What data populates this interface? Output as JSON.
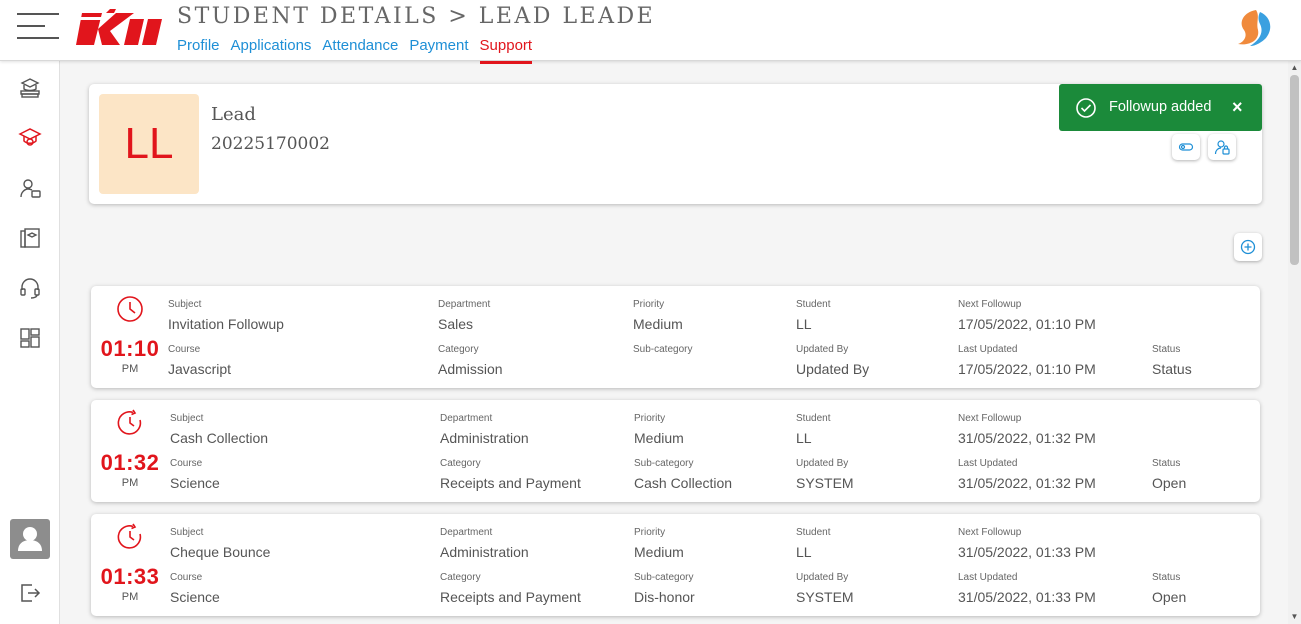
{
  "header": {
    "title": "STUDENT DETAILS > LEAD LEADE",
    "tabs": [
      {
        "label": "Profile",
        "active": false
      },
      {
        "label": "Applications",
        "active": false
      },
      {
        "label": "Attendance",
        "active": false
      },
      {
        "label": "Payment",
        "active": false
      },
      {
        "label": "Support",
        "active": true
      }
    ]
  },
  "icons": {
    "menu": "hamburger-icon",
    "logo": "kii-logo",
    "brand": "swirl-brand-icon",
    "sidebar": [
      "books-icon",
      "graduation-cap-icon",
      "user-card-icon",
      "courses-icon",
      "headset-icon",
      "dashboard-grid-icon",
      "user-avatar-icon",
      "logout-icon"
    ]
  },
  "colors": {
    "accent": "#e1151c",
    "link": "#1e8fd6",
    "success": "#1b8a3a",
    "initials_bg": "#fce5c6"
  },
  "profile": {
    "initials": "LL",
    "name": "Lead",
    "id": "20225170002"
  },
  "toast": {
    "text": "Followup added",
    "close": "×"
  },
  "tickets": [
    {
      "time": "01:10",
      "ampm": "PM",
      "subject_label": "Subject",
      "subject": "Invitation Followup",
      "department_label": "Department",
      "department": "Sales",
      "priority_label": "Priority",
      "priority": "Medium",
      "student_label": "Student",
      "student": "LL",
      "next_label": "Next Followup",
      "next": "17/05/2022, 01:10 PM",
      "course_label": "Course",
      "course": "Javascript",
      "category_label": "Category",
      "category": "Admission",
      "subcategory_label": "Sub-category",
      "subcategory": "",
      "updatedby_label": "Updated By",
      "updatedby": "Updated By",
      "last_label": "Last Updated",
      "last": "17/05/2022, 01:10 PM",
      "status_label": "Status",
      "status": "Status"
    },
    {
      "time": "01:32",
      "ampm": "PM",
      "subject_label": "Subject",
      "subject": "Cash Collection",
      "department_label": "Department",
      "department": "Administration",
      "priority_label": "Priority",
      "priority": "Medium",
      "student_label": "Student",
      "student": "LL",
      "next_label": "Next Followup",
      "next": "31/05/2022, 01:32 PM",
      "course_label": "Course",
      "course": "Science",
      "category_label": "Category",
      "category": "Receipts and Payment",
      "subcategory_label": "Sub-category",
      "subcategory": "Cash Collection",
      "updatedby_label": "Updated By",
      "updatedby": "SYSTEM",
      "last_label": "Last Updated",
      "last": "31/05/2022, 01:32 PM",
      "status_label": "Status",
      "status": "Open"
    },
    {
      "time": "01:33",
      "ampm": "PM",
      "subject_label": "Subject",
      "subject": "Cheque Bounce",
      "department_label": "Department",
      "department": "Administration",
      "priority_label": "Priority",
      "priority": "Medium",
      "student_label": "Student",
      "student": "LL",
      "next_label": "Next Followup",
      "next": "31/05/2022, 01:33 PM",
      "course_label": "Course",
      "course": "Science",
      "category_label": "Category",
      "category": "Receipts and Payment",
      "subcategory_label": "Sub-category",
      "subcategory": "Dis-honor",
      "updatedby_label": "Updated By",
      "updatedby": "SYSTEM",
      "last_label": "Last Updated",
      "last": "31/05/2022, 01:33 PM",
      "status_label": "Status",
      "status": "Open"
    }
  ]
}
